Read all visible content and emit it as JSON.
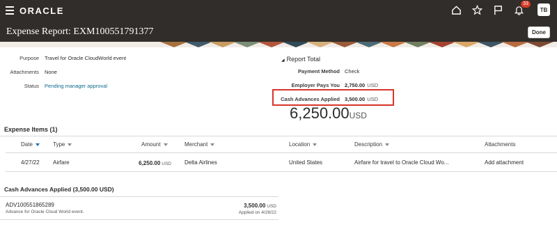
{
  "app": {
    "logo": "ORACLE",
    "notification_count": "33",
    "user_initials": "TB"
  },
  "header": {
    "title": "Expense Report: EXM100551791377",
    "done_label": "Done"
  },
  "details": {
    "purpose_label": "Purpose",
    "purpose_value": "Travel for Oracle CloudWorld event",
    "attachments_label": "Attachments",
    "attachments_value": "None",
    "status_label": "Status",
    "status_value": "Pending manager approval"
  },
  "report_total": {
    "heading": "Report Total",
    "payment_method_label": "Payment Method",
    "payment_method_value": "Check",
    "employer_pays_label": "Employer Pays You",
    "employer_pays_value": "2,750.00",
    "employer_pays_currency": "USD",
    "cash_adv_label": "Cash Advances Applied",
    "cash_adv_value": "3,500.00",
    "cash_adv_currency": "USD",
    "total_value": "6,250.00",
    "total_currency": "USD"
  },
  "expense_items": {
    "heading": "Expense Items (1)",
    "columns": {
      "date": "Date",
      "type": "Type",
      "amount": "Amount",
      "merchant": "Merchant",
      "location": "Location",
      "description": "Description",
      "attachments": "Attachments"
    },
    "rows": [
      {
        "date": "4/27/22",
        "type": "Airfare",
        "amount": "6,250.00",
        "currency": "USD",
        "merchant": "Delta Airlines",
        "location": "United States",
        "description": "Airfare for travel to Oracle Cloud Wo...",
        "attachment_action": "Add attachment"
      }
    ]
  },
  "cash_advances": {
    "heading": "Cash Advances Applied (3,500.00 USD)",
    "items": [
      {
        "id": "ADV100551865289",
        "description": "Advance for Oracle Cloud World event.",
        "amount": "3,500.00",
        "currency": "USD",
        "applied_label": "Applied on",
        "applied_date": "4/28/22"
      }
    ]
  },
  "colors": {
    "header_bg": "#312d2a",
    "link": "#0d6b8d",
    "highlight": "#d9342b",
    "badge": "#d63b25"
  },
  "icons": [
    "hamburger-icon",
    "home-icon",
    "star-icon",
    "flag-icon",
    "bell-icon",
    "sort-arrow-icon"
  ]
}
